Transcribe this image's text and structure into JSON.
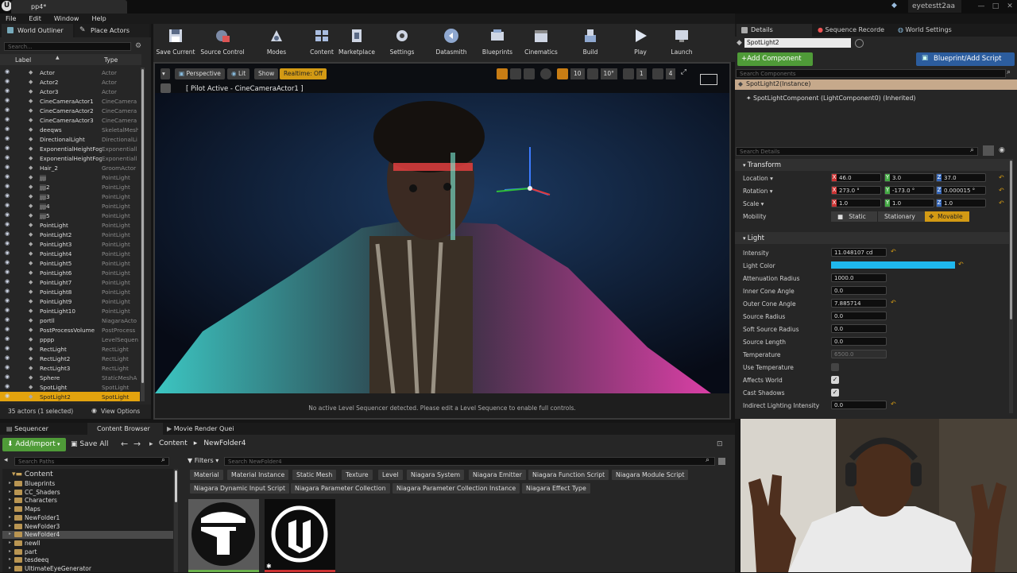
{
  "titlebar": {
    "tab_title": "pp4*",
    "user": "eyetestt2aa"
  },
  "menu": [
    "File",
    "Edit",
    "Window",
    "Help"
  ],
  "outliner": {
    "tab_outliner": "World Outliner",
    "tab_place": "Place Actors",
    "search_placeholder": "Search...",
    "col_label": "Label",
    "col_type": "Type",
    "rows": [
      {
        "label": "Actor",
        "type": "Actor"
      },
      {
        "label": "Actor2",
        "type": "Actor"
      },
      {
        "label": "Actor3",
        "type": "Actor"
      },
      {
        "label": "CineCameraActor1",
        "type": "CineCamera"
      },
      {
        "label": "CineCameraActor2",
        "type": "CineCamera"
      },
      {
        "label": "CineCameraActor3",
        "type": "CineCamera"
      },
      {
        "label": "deeqws",
        "type": "SkeletalMesh"
      },
      {
        "label": "DirectionalLight",
        "type": "DirectionalLi"
      },
      {
        "label": "ExponentialHeightFog",
        "type": "Exponentiall"
      },
      {
        "label": "ExponentialHeightFog",
        "type": "Exponentiall"
      },
      {
        "label": "Hair_2",
        "type": "GroomActor"
      },
      {
        "label": "jjjj",
        "type": "PointLight"
      },
      {
        "label": "jjjj2",
        "type": "PointLight"
      },
      {
        "label": "jjjj3",
        "type": "PointLight"
      },
      {
        "label": "jjjj4",
        "type": "PointLight"
      },
      {
        "label": "jjjj5",
        "type": "PointLight"
      },
      {
        "label": "PointLight",
        "type": "PointLight"
      },
      {
        "label": "PointLight2",
        "type": "PointLight"
      },
      {
        "label": "PointLight3",
        "type": "PointLight"
      },
      {
        "label": "PointLight4",
        "type": "PointLight"
      },
      {
        "label": "PointLight5",
        "type": "PointLight"
      },
      {
        "label": "PointLight6",
        "type": "PointLight"
      },
      {
        "label": "PointLight7",
        "type": "PointLight"
      },
      {
        "label": "PointLight8",
        "type": "PointLight"
      },
      {
        "label": "PointLight9",
        "type": "PointLight"
      },
      {
        "label": "PointLight10",
        "type": "PointLight"
      },
      {
        "label": "portll",
        "type": "NiagaraActo"
      },
      {
        "label": "PostProcessVolume",
        "type": "PostProcess"
      },
      {
        "label": "pppp",
        "type": "LevelSequen"
      },
      {
        "label": "RectLight",
        "type": "RectLight"
      },
      {
        "label": "RectLight2",
        "type": "RectLight"
      },
      {
        "label": "RectLight3",
        "type": "RectLight"
      },
      {
        "label": "Sphere",
        "type": "StaticMeshA"
      },
      {
        "label": "SpotLight",
        "type": "SpotLight"
      },
      {
        "label": "SpotLight2",
        "type": "SpotLight"
      }
    ],
    "status": "35 actors (1 selected)",
    "view_options": "View Options"
  },
  "toolbar": [
    {
      "label": "Save Current",
      "icon": "save-icon"
    },
    {
      "label": "Source Control",
      "icon": "source-control-icon"
    },
    {
      "label": "Modes",
      "icon": "modes-icon"
    },
    {
      "label": "Content",
      "icon": "content-icon"
    },
    {
      "label": "Marketplace",
      "icon": "marketplace-icon"
    },
    {
      "label": "Settings",
      "icon": "settings-icon"
    },
    {
      "label": "Datasmith",
      "icon": "datasmith-icon"
    },
    {
      "label": "Blueprints",
      "icon": "blueprints-icon"
    },
    {
      "label": "Cinematics",
      "icon": "cinematics-icon"
    },
    {
      "label": "Build",
      "icon": "build-icon"
    },
    {
      "label": "Play",
      "icon": "play-icon"
    },
    {
      "label": "Launch",
      "icon": "launch-icon"
    }
  ],
  "viewport": {
    "perspective": "Perspective",
    "lit": "Lit",
    "show": "Show",
    "realtime": "Realtime: Off",
    "pilot": "[ Pilot Active - CineCameraActor1 ]",
    "snap_grid": "10",
    "snap_rot": "10°",
    "snap_scale": "1",
    "cam_speed": "4",
    "layers": "1",
    "message": "No active Level Sequencer detected. Please edit a Level Sequence to enable full controls."
  },
  "details": {
    "tab_details": "Details",
    "tab_seq": "Sequence Recorde",
    "tab_world": "World Settings",
    "actor_name": "SpotLight2",
    "add_component": "+Add Component",
    "blueprint": "Blueprint/Add Script",
    "search_components": "Search Components",
    "instance": "SpotLight2(Instance)",
    "component": "SpotLightComponent (LightComponent0) (Inherited)",
    "search_details": "Search Details",
    "transform_header": "Transform",
    "location_label": "Location",
    "location": [
      "46.0",
      "3.0",
      "37.0"
    ],
    "rotation_label": "Rotation",
    "rotation": [
      "273.0 °",
      "-173.0 °",
      "0.000015 °"
    ],
    "scale_label": "Scale",
    "scale": [
      "1.0",
      "1.0",
      "1.0"
    ],
    "mobility_label": "Mobility",
    "mobility_options": [
      "Static",
      "Stationary",
      "Movable"
    ],
    "light_header": "Light",
    "props": [
      {
        "label": "Intensity",
        "value": "11.048107 cd"
      },
      {
        "label": "Light Color",
        "value": ""
      },
      {
        "label": "Attenuation Radius",
        "value": "1000.0"
      },
      {
        "label": "Inner Cone Angle",
        "value": "0.0"
      },
      {
        "label": "Outer Cone Angle",
        "value": "7.885714"
      },
      {
        "label": "Source Radius",
        "value": "0.0"
      },
      {
        "label": "Soft Source Radius",
        "value": "0.0"
      },
      {
        "label": "Source Length",
        "value": "0.0"
      },
      {
        "label": "Temperature",
        "value": "6500.0"
      },
      {
        "label": "Use Temperature",
        "value": ""
      },
      {
        "label": "Affects World",
        "value": ""
      },
      {
        "label": "Cast Shadows",
        "value": ""
      },
      {
        "label": "Indirect Lighting Intensity",
        "value": "0.0"
      }
    ],
    "light_color": "#1fb8ee"
  },
  "content_browser": {
    "tab_sequencer": "Sequencer",
    "tab_cb": "Content Browser",
    "tab_mrq": "Movie Render Quei",
    "add_import": "Add/Import",
    "save_all": "Save All",
    "path_root": "Content",
    "path_folder": "NewFolder4",
    "search_paths": "Search Paths",
    "filters": "Filters",
    "search_folder": "Search NewFolder4",
    "chips_row1": [
      "Material",
      "Material Instance",
      "Static Mesh",
      "Texture",
      "Level",
      "Niagara System",
      "Niagara Emitter",
      "Niagara Function Script",
      "Niagara Module Script"
    ],
    "chips_row2": [
      "Niagara Dynamic Input Script",
      "Niagara Parameter Collection",
      "Niagara Parameter Collection Instance",
      "Niagara Effect Type"
    ],
    "tree_root": "Content",
    "tree": [
      "Blueprints",
      "CC_Shaders",
      "Characters",
      "Maps",
      "NewFolder1",
      "NewFolder3",
      "NewFolder4",
      "newll",
      "part",
      "tesdeeq",
      "UltimateEyeGenerator"
    ]
  }
}
